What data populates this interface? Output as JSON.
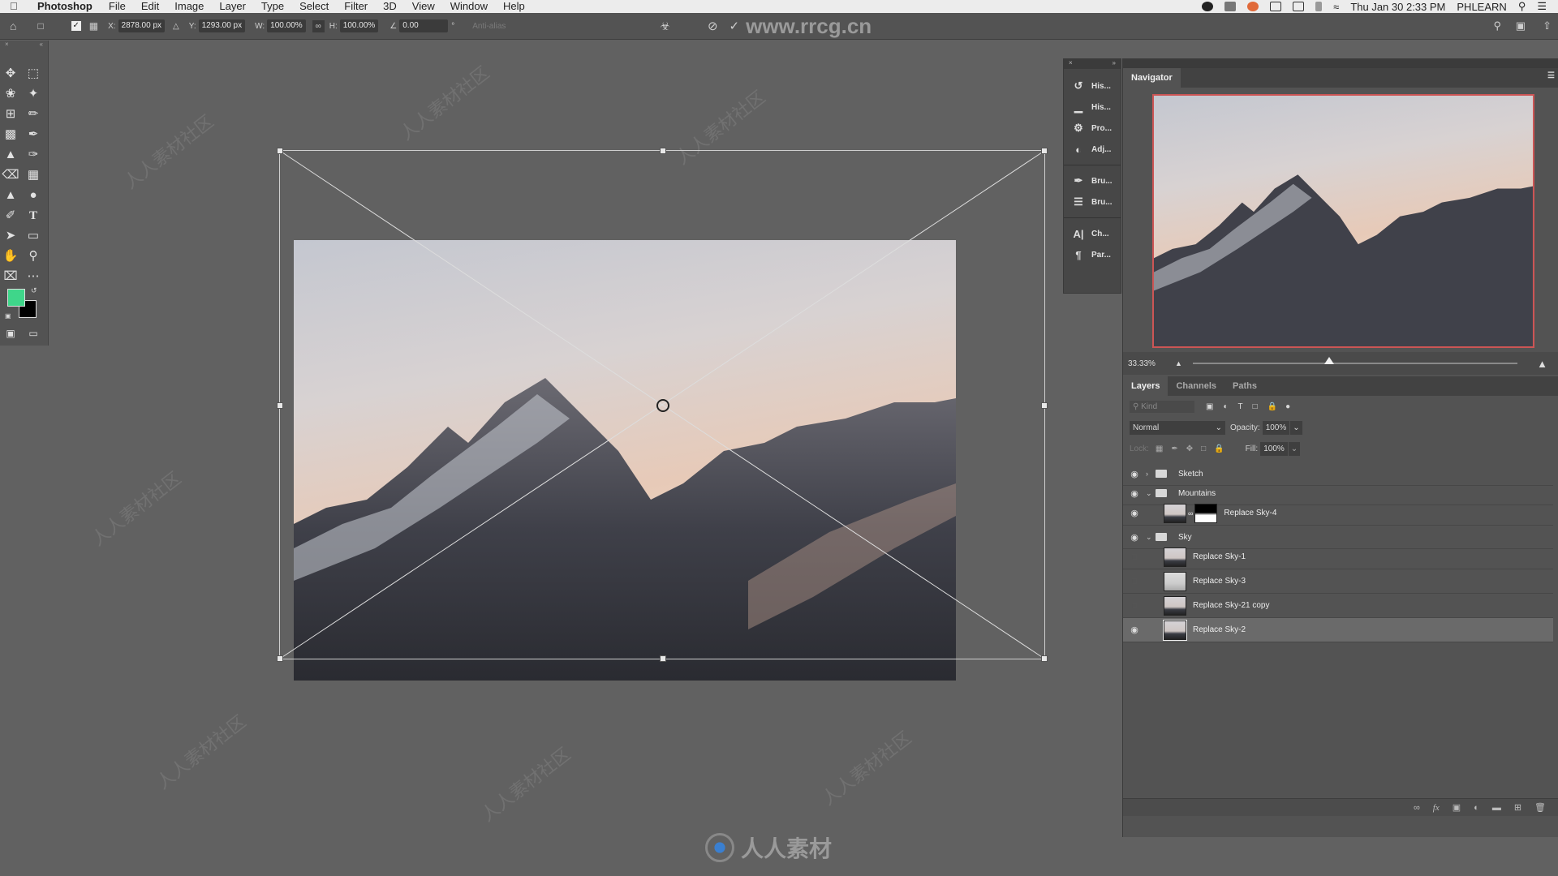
{
  "menubar": {
    "app": "Photoshop",
    "items": [
      "File",
      "Edit",
      "Image",
      "Layer",
      "Type",
      "Select",
      "Filter",
      "3D",
      "View",
      "Window",
      "Help"
    ],
    "clock": "Thu Jan 30  2:33 PM",
    "user": "PHLEARN"
  },
  "options": {
    "x_label": "X:",
    "x_value": "2878.00 px",
    "y_label": "Y:",
    "y_value": "1293.00 px",
    "w_label": "W:",
    "w_value": "100.00%",
    "h_label": "H:",
    "h_value": "100.00%",
    "angle_value": "0.00",
    "antialias_label": "Anti-alias",
    "watermark": "www.rrcg.cn"
  },
  "icon_panel": {
    "items": [
      {
        "icon": "history-icon",
        "label": "His..."
      },
      {
        "icon": "histogram-icon",
        "label": "His..."
      },
      {
        "icon": "properties-icon",
        "label": "Pro..."
      },
      {
        "icon": "adjustments-icon",
        "label": "Adj..."
      },
      {
        "icon": "brush-settings-icon",
        "label": "Bru..."
      },
      {
        "icon": "brushes-icon",
        "label": "Bru..."
      },
      {
        "icon": "character-icon",
        "label": "Ch..."
      },
      {
        "icon": "paragraph-icon",
        "label": "Par..."
      }
    ]
  },
  "navigator": {
    "tab": "Navigator",
    "zoom": "33.33%",
    "zoom_slider_fraction": 0.42
  },
  "layers_panel": {
    "tabs": [
      "Layers",
      "Channels",
      "Paths"
    ],
    "active_tab": "Layers",
    "filter_placeholder": "Kind",
    "blend_mode": "Normal",
    "opacity_label": "Opacity:",
    "opacity": "100%",
    "lock_label": "Lock:",
    "fill_label": "Fill:",
    "fill": "100%",
    "layers": [
      {
        "name": "Sketch",
        "type": "group",
        "visible": true,
        "expanded": false,
        "indent": 0
      },
      {
        "name": "Mountains",
        "type": "group",
        "visible": true,
        "expanded": true,
        "indent": 0
      },
      {
        "name": "Replace Sky-4",
        "type": "smart-object-with-mask",
        "visible": true,
        "indent": 1
      },
      {
        "name": "Sky",
        "type": "group",
        "visible": true,
        "expanded": true,
        "indent": 0
      },
      {
        "name": "Replace Sky-1",
        "type": "smart-object",
        "visible": false,
        "indent": 1
      },
      {
        "name": "Replace Sky-3",
        "type": "smart-object",
        "visible": false,
        "indent": 1
      },
      {
        "name": "Replace Sky-21 copy",
        "type": "smart-object",
        "visible": false,
        "indent": 1
      },
      {
        "name": "Replace Sky-2",
        "type": "smart-object",
        "visible": true,
        "indent": 1,
        "selected": true
      }
    ],
    "footer_icons": [
      "link-icon",
      "fx-icon",
      "mask-icon",
      "adjustment-icon",
      "group-icon",
      "new-layer-icon",
      "trash-icon"
    ]
  },
  "colors": {
    "foreground": "#3fd68a",
    "background": "#000000"
  },
  "watermark_bottom": "人人素材",
  "watermark_tile": "人人素材社区"
}
